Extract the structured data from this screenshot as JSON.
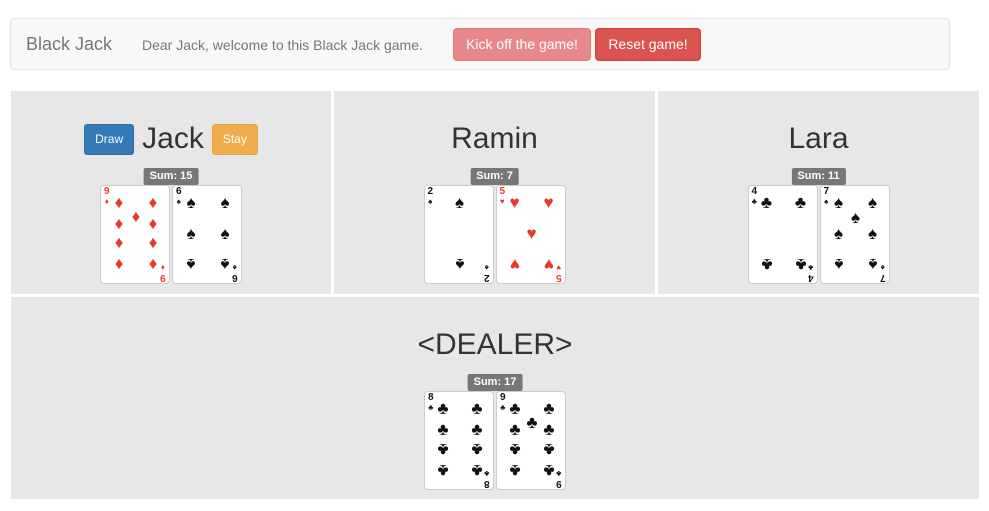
{
  "navbar": {
    "brand": "Black Jack",
    "welcome": "Dear Jack, welcome to this Black Jack game.",
    "kickoff_label": "Kick off the game!",
    "reset_label": "Reset game!"
  },
  "players": [
    {
      "name": "Jack",
      "draw_label": "Draw",
      "stay_label": "Stay",
      "sum": "Sum: 15",
      "cards": [
        {
          "rank": "9",
          "suit": "diamonds",
          "symbol": "♦",
          "color": "#e23c2c"
        },
        {
          "rank": "6",
          "suit": "spades",
          "symbol": "♠",
          "color": "#111111"
        }
      ]
    },
    {
      "name": "Ramin",
      "sum": "Sum: 7",
      "cards": [
        {
          "rank": "2",
          "suit": "spades",
          "symbol": "♠",
          "color": "#111111"
        },
        {
          "rank": "5",
          "suit": "hearts",
          "symbol": "♥",
          "color": "#e23c2c"
        }
      ]
    },
    {
      "name": "Lara",
      "sum": "Sum: 11",
      "cards": [
        {
          "rank": "4",
          "suit": "clubs",
          "symbol": "♣",
          "color": "#111111"
        },
        {
          "rank": "7",
          "suit": "spades",
          "symbol": "♠",
          "color": "#111111"
        }
      ]
    }
  ],
  "dealer": {
    "name": "<DEALER>",
    "sum": "Sum: 17",
    "cards": [
      {
        "rank": "8",
        "suit": "clubs",
        "symbol": "♣",
        "color": "#111111"
      },
      {
        "rank": "9",
        "suit": "clubs",
        "symbol": "♣",
        "color": "#111111"
      }
    ]
  },
  "colors": {
    "panel_bg": "#e7e7e7",
    "draw_button": "#337ab7",
    "stay_button": "#f0ad4e",
    "kickoff_button": "#e8888a",
    "reset_button": "#d9534f",
    "badge": "#777777"
  }
}
